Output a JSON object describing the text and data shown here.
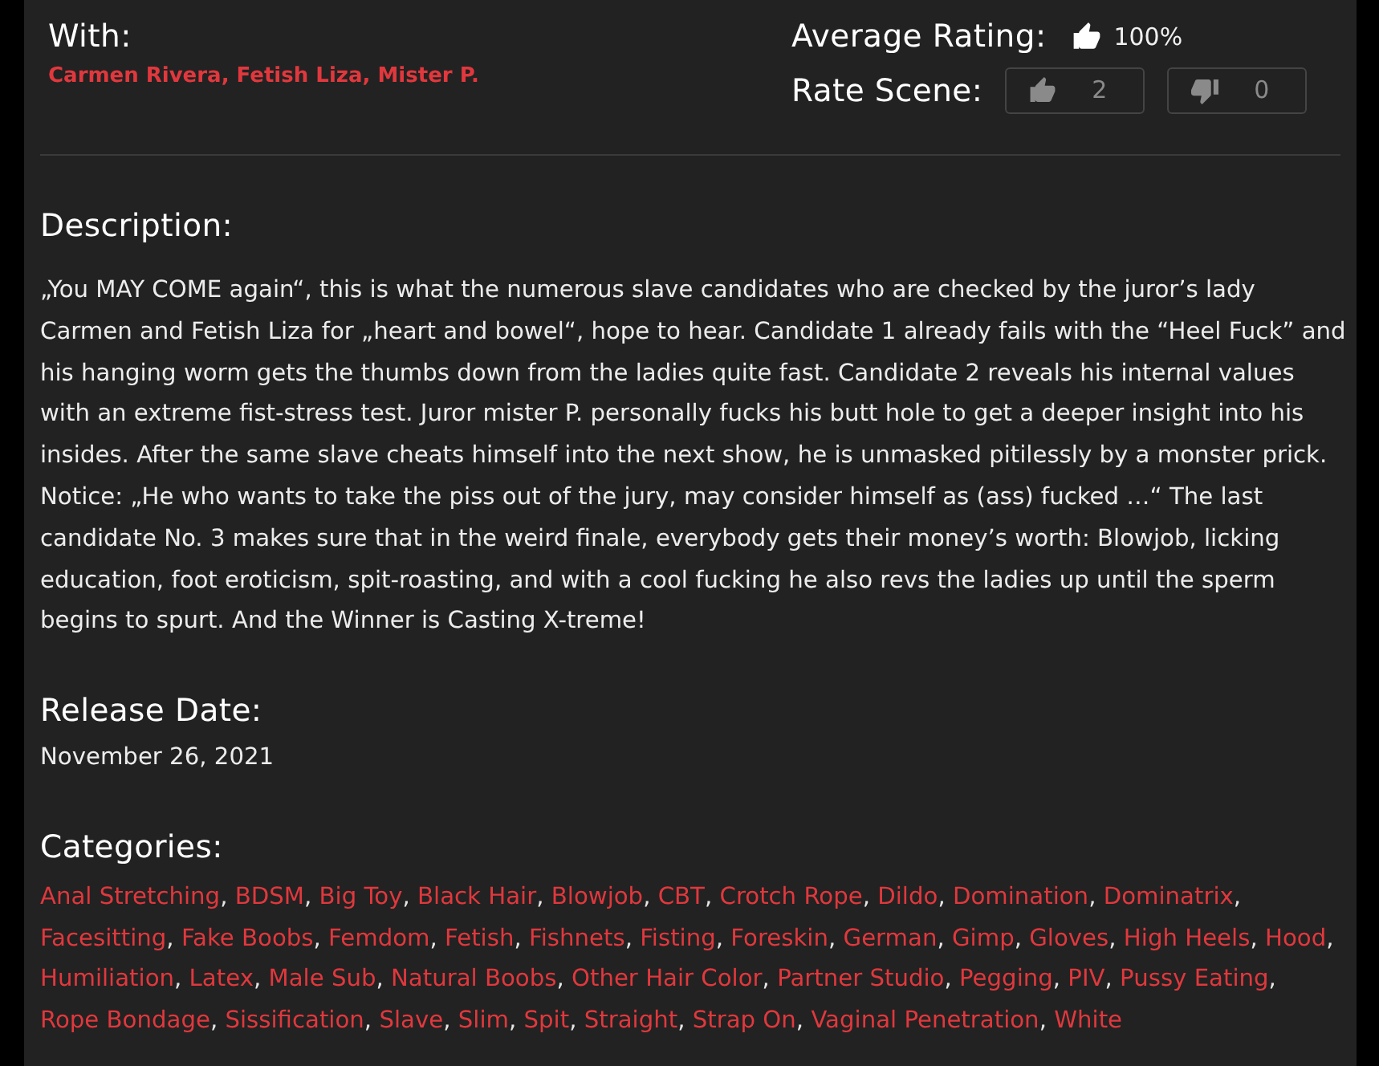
{
  "with": {
    "label": "With:",
    "separator": ",",
    "performers": [
      "Carmen Rivera",
      "Fetish Liza",
      "Mister P."
    ]
  },
  "rating": {
    "average_label": "Average Rating:",
    "average_value": "100%",
    "rate_label": "Rate Scene:",
    "votes": [
      {
        "kind": "up",
        "count": "2"
      },
      {
        "kind": "down",
        "count": "0"
      }
    ]
  },
  "description": {
    "heading": "Description:",
    "text": "„You MAY COME again“, this is what the numerous slave candidates who are checked by the juror’s lady Carmen and Fetish Liza for „heart and bowel“, hope to hear. Candidate 1 already fails with the “Heel Fuck” and his hanging worm gets the thumbs down from the ladies quite fast. Candidate 2 reveals his internal values with an extreme fist-stress test. Juror mister P. personally fucks his butt hole to get a deeper insight into his insides. After the same slave cheats himself into the next show, he is unmasked pitilessly by a monster prick. Notice: „He who wants to take the piss out of the jury, may consider himself as (ass) fucked …“ The last candidate No. 3 makes sure that in the weird finale, everybody gets their money’s worth: Blowjob, licking education, foot eroticism, spit-roasting, and with a cool fucking he also revs the ladies up until the sperm begins to spurt. And the Winner is Casting X-treme!"
  },
  "release_date": {
    "heading": "Release Date:",
    "value": "November 26, 2021"
  },
  "categories": {
    "heading": "Categories:",
    "separator": ",",
    "items": [
      "Anal Stretching",
      "BDSM",
      "Big Toy",
      "Black Hair",
      "Blowjob",
      "CBT",
      "Crotch Rope",
      "Dildo",
      "Domination",
      "Dominatrix",
      "Facesitting",
      "Fake Boobs",
      "Femdom",
      "Fetish",
      "Fishnets",
      "Fisting",
      "Foreskin",
      "German",
      "Gimp",
      "Gloves",
      "High Heels",
      "Hood",
      "Humiliation",
      "Latex",
      "Male Sub",
      "Natural Boobs",
      "Other Hair Color",
      "Partner Studio",
      "Pegging",
      "PIV",
      "Pussy Eating",
      "Rope Bondage",
      "Sissification",
      "Slave",
      "Slim",
      "Spit",
      "Straight",
      "Strap On",
      "Vaginal Penetration",
      "White"
    ]
  }
}
